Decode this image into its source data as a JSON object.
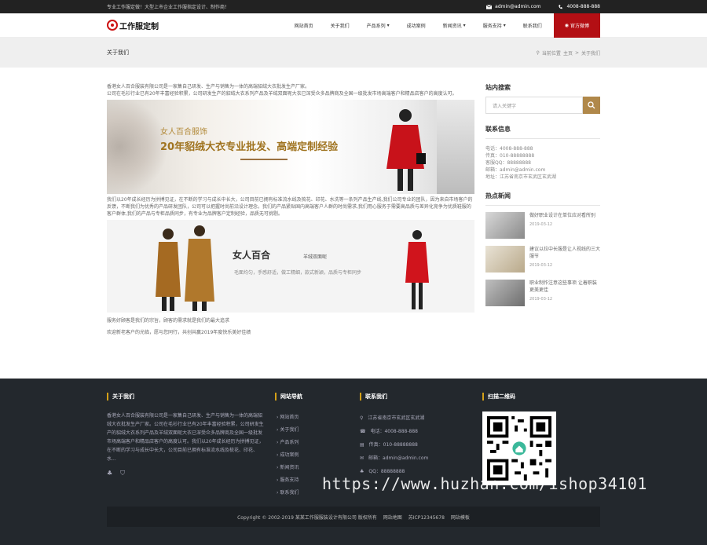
{
  "topbar": {
    "slogan": "专业工作服定做！大型上市企业工作服指定设计、制作商！",
    "email": "admin@admin.com",
    "phone": "4008-888-888"
  },
  "header": {
    "logo_text": "工作服定制",
    "nav": [
      "网站首页",
      "关于我们",
      "产品系列",
      "成功案例",
      "新闻资讯",
      "服务支持",
      "联系我们"
    ],
    "cta": "官方微博"
  },
  "band": {
    "title": "关于我们",
    "crumb_prefix": "当前位置",
    "crumb_home": "主页",
    "crumb_sep": ">",
    "crumb_current": "关于我们"
  },
  "content": {
    "p1": "香港女人百合服装有限公司是一家集自己研发、生产与销售为一体的高端貂绒大衣批发生产厂家。",
    "p2": "公司在毛衫行业已有20年丰富经验积累，公司研发生产的貂绒大衣系列产品及羊绒双面呢大衣已深受众多品牌商及全国一级批发市场高端客户和精品店客户的高度认可。",
    "banner1_sub": "女人百合服饰",
    "banner1_main": "20年貂绒大衣专业批发、高端定制经验",
    "p3": "我们以20年成长经历为拼搏见证，在不断的学习与成长中长大，公司目前已拥有标准流水线及梳花、印花、水洗等一条列产品生产线,我们公司专业的团队，因为来自市场客户的反馈，不断我们为优秀的产品研发团队，公司可以把握时尚前沿设计理念，我们的产品紧贴国内高端客户人群的时尚需求,我们用心服务于需要高品质与差异化竞争为优质鞋服的客户群体,我们的产品与专柜品质同步，有专业为品牌客户定制经验，品质无可挑剔。",
    "banner2_title": "女人百合",
    "banner2_small": "羊绒双面呢",
    "banner2_tag": "毛面均匀，手感舒适，做工精细，款式新颖，品质与专柜同步",
    "p4": "服务好顾客是我们的宗旨，顾客的需求就是我们的最大追求",
    "p5": "欢迎新老客户的光临，愿与您同行，共创共赢2019年度快乐美好佳绩"
  },
  "sidebar": {
    "search_title": "站内搜索",
    "search_placeholder": "请入关键字",
    "contact_title": "联系信息",
    "contact": [
      "电话：4008-888-888",
      "传真：010-88888888",
      "客服QQ：88888888",
      "邮箱：admin@admin.com",
      "地址：江苏省南京市玄武区玄武湖"
    ],
    "news_title": "热点新闻",
    "news": [
      {
        "title": "做好职业设计在单位应对看所别",
        "date": "2019-03-12"
      },
      {
        "title": "建议以拉中长服是让人视线的三大服节",
        "date": "2019-03-12"
      },
      {
        "title": "职业制作注意这些事项 让着职装更美更佳",
        "date": "2019-03-12"
      }
    ]
  },
  "footer": {
    "about_title": "关于我们",
    "about_text": "香港女人百合服装有限公司是一家集自己研发、生产与销售为一体的高端貂绒大衣批发生产厂家。公司在毛衫行业已有20年丰富经验积累，公司研发生产的貂绒大衣系列产品及羊绒双面呢大衣已深受众多品牌商及全国一级批发市场高端客户和精品店客户的高度认可。我们以20年成长经历为拼搏见证，在不断的学习与成长中长大，公司目前已拥有标准流水线及梳花、印花、水...",
    "nav_title": "网站导航",
    "nav": [
      "网站首页",
      "关于我们",
      "产品系列",
      "成功案例",
      "新闻资讯",
      "服务支持",
      "联系我们"
    ],
    "contact_title": "联系我们",
    "contact": [
      {
        "icon": "location-icon",
        "text": "江苏省南京市玄武区玄武湖"
      },
      {
        "icon": "phone-icon",
        "text": "电话：4008-888-888"
      },
      {
        "icon": "fax-icon",
        "text": "传真：010-88888888"
      },
      {
        "icon": "mail-icon",
        "text": "邮箱：admin@admin.com"
      },
      {
        "icon": "qq-icon",
        "text": "QQ：88888888"
      }
    ],
    "qr_title": "扫描二维码",
    "copyright": "Copyright © 2002-2019 某某工作服服装设计有限公司 版权所有",
    "links": [
      "网站地图",
      "苏ICP12345678",
      "网站模板"
    ]
  },
  "watermark": "https://www.huzhan.com/ishop34101"
}
